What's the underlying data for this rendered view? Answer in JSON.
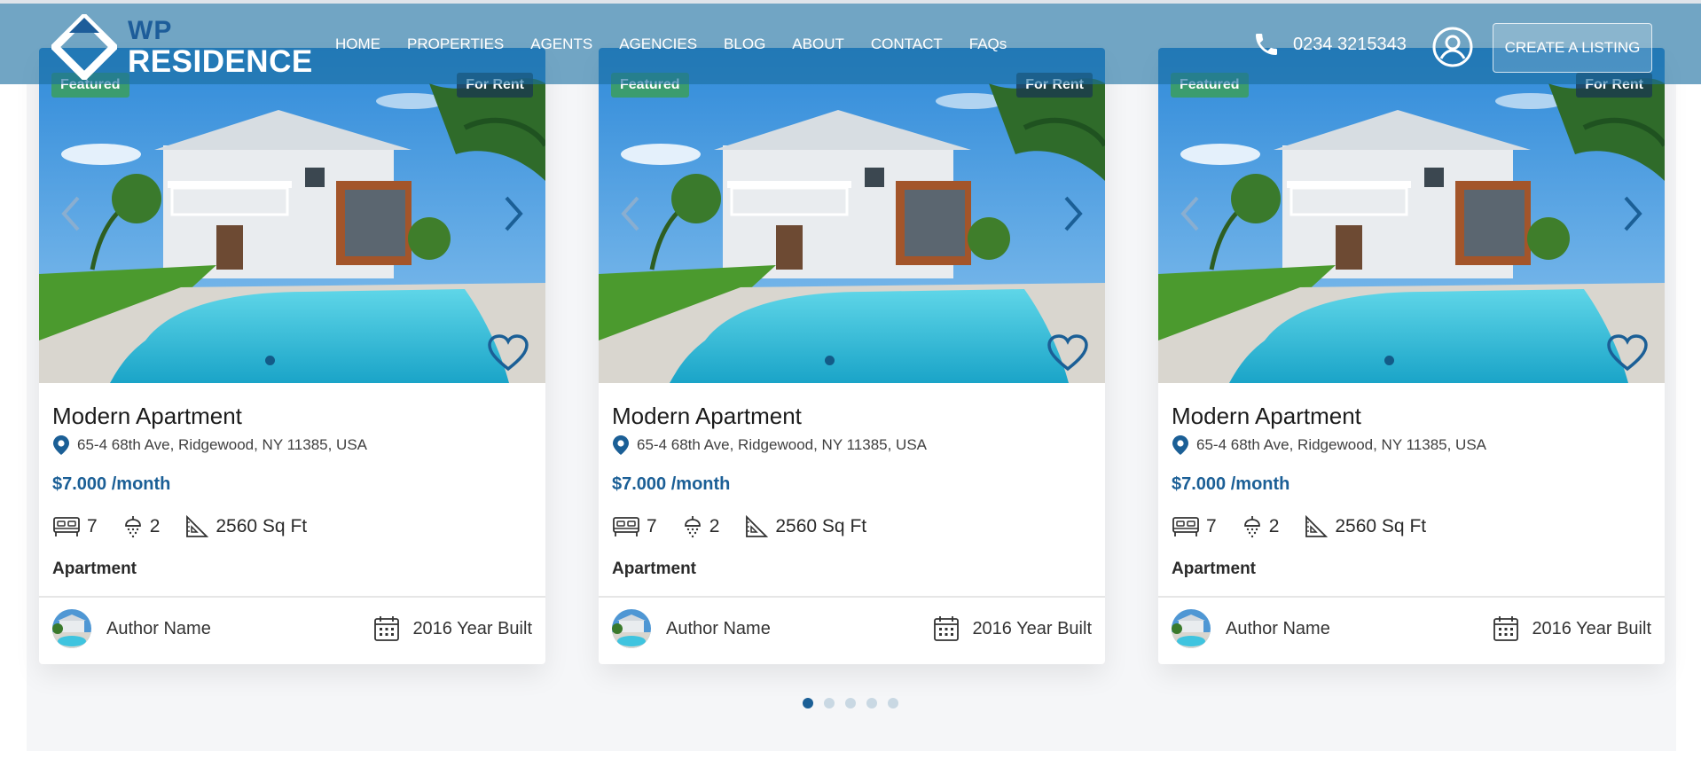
{
  "brand": {
    "line1": "WP",
    "line2": "RESIDENCE"
  },
  "nav": [
    "HOME",
    "PROPERTIES",
    "AGENTS",
    "AGENCIES",
    "BLOG",
    "ABOUT",
    "CONTACT",
    "FAQs"
  ],
  "phone": "0234 3215343",
  "cta_label": "CREATE A LISTING",
  "colors": {
    "accent": "#1b5f96",
    "featured_badge": "#3b9c6e",
    "header_bg": "#1a6ea0"
  },
  "icons": [
    "phone-icon",
    "user-icon",
    "map-pin-icon",
    "bed-icon",
    "shower-icon",
    "area-icon",
    "calendar-icon",
    "heart-icon",
    "chevron-left-icon",
    "chevron-right-icon"
  ],
  "cards": [
    {
      "badge_featured": "Featured",
      "badge_status": "For Rent",
      "title": "Modern Apartment",
      "address": "65-4 68th Ave, Ridgewood, NY 11385, USA",
      "price": "$7.000 /month",
      "beds": "7",
      "baths": "2",
      "area": "2560 Sq Ft",
      "type": "Apartment",
      "author": "Author Name",
      "year": "2016 Year Built"
    },
    {
      "badge_featured": "Featured",
      "badge_status": "For Rent",
      "title": "Modern Apartment",
      "address": "65-4 68th Ave, Ridgewood, NY 11385, USA",
      "price": "$7.000 /month",
      "beds": "7",
      "baths": "2",
      "area": "2560 Sq Ft",
      "type": "Apartment",
      "author": "Author Name",
      "year": "2016 Year Built"
    },
    {
      "badge_featured": "Featured",
      "badge_status": "For Rent",
      "title": "Modern Apartment",
      "address": "65-4 68th Ave, Ridgewood, NY 11385, USA",
      "price": "$7.000 /month",
      "beds": "7",
      "baths": "2",
      "area": "2560 Sq Ft",
      "type": "Apartment",
      "author": "Author Name",
      "year": "2016 Year Built"
    }
  ],
  "carousel": {
    "pages": 5,
    "active_page": 1
  }
}
